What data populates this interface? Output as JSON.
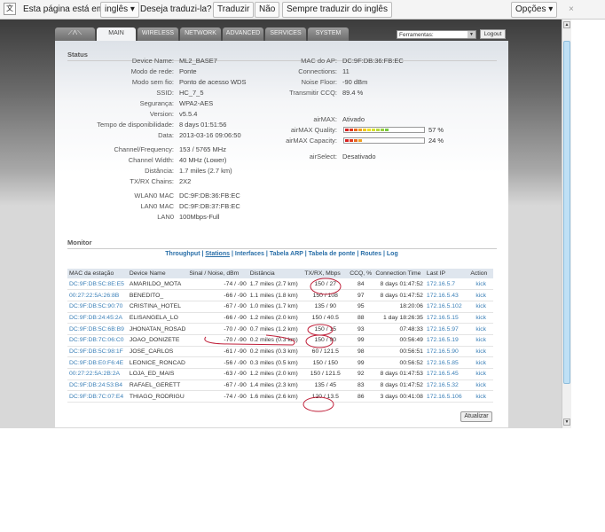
{
  "translate_bar": {
    "prompt": "Esta página está em",
    "language": "inglês",
    "question": "Deseja traduzi-la?",
    "translate": "Traduzir",
    "no": "Não",
    "always": "Sempre traduzir do inglês",
    "options": "Opções",
    "close": "×"
  },
  "tabs": [
    "MAIN",
    "WIRELESS",
    "NETWORK",
    "ADVANCED",
    "SERVICES",
    "SYSTEM"
  ],
  "tools": {
    "select": "Ferramentas:",
    "logout": "Logout"
  },
  "status": {
    "title": "Status",
    "left": [
      [
        "Device Name:",
        "ML2_BASE7"
      ],
      [
        "Modo de rede:",
        "Ponte"
      ],
      [
        "Modo sem fio:",
        "Ponto de acesso WDS"
      ],
      [
        "SSID:",
        "HC_7_5"
      ],
      [
        "Segurança:",
        "WPA2-AES"
      ],
      [
        "Version:",
        "v5.5.4"
      ],
      [
        "Tempo de disponibilidade:",
        "8 days 01:51:56"
      ],
      [
        "Data:",
        "2013-03-16 09:06:50"
      ],
      [
        "Channel/Frequency:",
        "153 / 5765 MHz"
      ],
      [
        "Channel Width:",
        "40 MHz (Lower)"
      ],
      [
        "Distância:",
        "1.7 miles (2.7 km)"
      ],
      [
        "TX/RX Chains:",
        "2X2"
      ],
      [
        "WLAN0 MAC",
        "DC:9F:DB:36:FB:EC"
      ],
      [
        "LAN0 MAC",
        "DC:9F:DB:37:FB:EC"
      ],
      [
        "LAN0",
        "100Mbps-Full"
      ]
    ],
    "right": [
      [
        "MAC do AP:",
        "DC:9F:DB:36:FB:EC"
      ],
      [
        "Connections:",
        "11"
      ],
      [
        "Noise Floor:",
        "-90 dBm"
      ],
      [
        "Transmitir CCQ:",
        "89.4 %"
      ],
      [
        "airMAX:",
        "Ativado"
      ]
    ],
    "airmax_quality": {
      "label": "airMAX Quality:",
      "value": "57 %",
      "percent": 57
    },
    "airmax_capacity": {
      "label": "airMAX Capacity:",
      "value": "24 %",
      "percent": 24
    },
    "airselect": [
      "airSelect:",
      "Desativado"
    ]
  },
  "monitor": {
    "title": "Monitor",
    "links": [
      "Throughput",
      "Stations",
      "Interfaces",
      "Tabela ARP",
      "Tabela de ponte",
      "Routes",
      "Log"
    ],
    "selected": "Stations",
    "columns": [
      "MAC da estação",
      "Device Name",
      "Sinal / Noise, dBm",
      "Distância",
      "TX/RX, Mbps",
      "CCQ, %",
      "Connection Time",
      "Last IP",
      "Action"
    ],
    "rows": [
      [
        "DC:9F:DB:5C:8E:E5",
        "AMARILDO_MOTA",
        "-74 / -90",
        "1.7 miles (2.7 km)",
        "150 / 27",
        "84",
        "8 days 01:47:52",
        "172.16.5.7",
        "kick"
      ],
      [
        "00:27:22:5A:26:8B",
        "BENEDITO_",
        "-66 / -90",
        "1.1 miles (1.8 km)",
        "150 / 108",
        "97",
        "8 days 01:47:52",
        "172.16.5.43",
        "kick"
      ],
      [
        "DC:9F:DB:5C:90:70",
        "CRISTINA_HOTEL",
        "-67 / -90",
        "1.0 miles (1.7 km)",
        "135 / 90",
        "95",
        "18:20:06",
        "172.16.5.102",
        "kick"
      ],
      [
        "DC:9F:DB:24:45:2A",
        "ELISANGELA_LO",
        "-66 / -90",
        "1.2 miles (2.0 km)",
        "150 / 40.5",
        "88",
        "1 day 18:26:35",
        "172.16.5.15",
        "kick"
      ],
      [
        "DC:9F:DB:5C:6B:B9",
        "JHONATAN_ROSAD",
        "-70 / -90",
        "0.7 miles (1.2 km)",
        "150 / 15",
        "93",
        "07:48:33",
        "172.16.5.97",
        "kick"
      ],
      [
        "DC:9F:DB:7C:06:C0",
        "JOAO_DONIZETE",
        "-70 / -90",
        "0.2 miles (0.3 km)",
        "150 / 90",
        "99",
        "00:56:49",
        "172.16.5.19",
        "kick"
      ],
      [
        "DC:9F:DB:5C:98:1F",
        "JOSE_CARLOS",
        "-61 / -90",
        "0.2 miles (0.3 km)",
        "60 / 121.5",
        "98",
        "00:56:51",
        "172.16.5.90",
        "kick"
      ],
      [
        "DC:9F:DB:E0:F6:4E",
        "LEONICE_RONCAD",
        "-56 / -90",
        "0.3 miles (0.5 km)",
        "150 / 150",
        "99",
        "00:56:52",
        "172.16.5.85",
        "kick"
      ],
      [
        "00:27:22:5A:2B:2A",
        "LOJA_ED_MAIS",
        "-63 / -90",
        "1.2 miles (2.0 km)",
        "150 / 121.5",
        "92",
        "8 days 01:47:53",
        "172.16.5.45",
        "kick"
      ],
      [
        "DC:9F:DB:24:53:B4",
        "RAFAEL_GERETT",
        "-67 / -90",
        "1.4 miles (2.3 km)",
        "135 / 45",
        "83",
        "8 days 01:47:52",
        "172.16.5.32",
        "kick"
      ],
      [
        "DC:9F:DB:7C:07:E4",
        "THIAGO_RODRIGU",
        "-74 / -90",
        "1.6 miles (2.6 km)",
        "120 / 13.5",
        "86",
        "3 days 00:41:08",
        "172.16.5.106",
        "kick"
      ]
    ],
    "refresh": "Atualizar"
  },
  "colors": {
    "link": "#3c80b8",
    "annotation": "#c0203a"
  }
}
